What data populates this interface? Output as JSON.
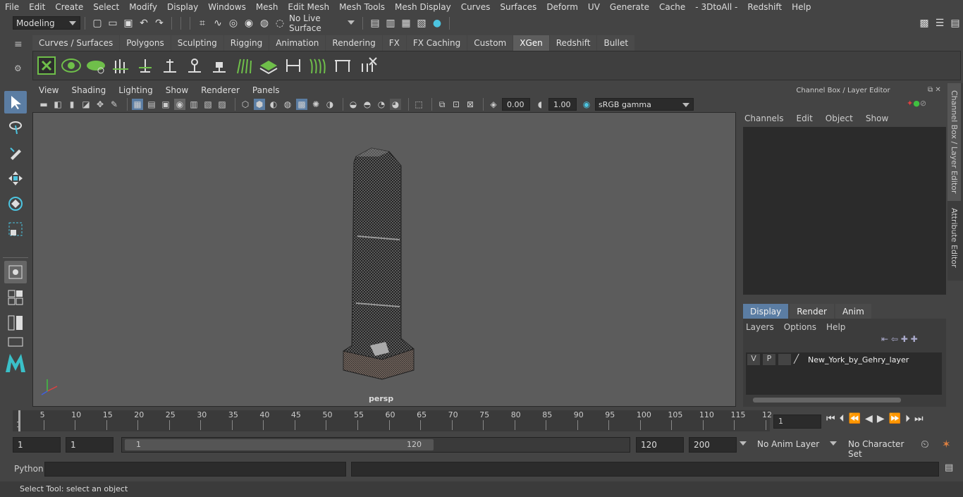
{
  "menu": [
    "File",
    "Edit",
    "Create",
    "Select",
    "Modify",
    "Display",
    "Windows",
    "Mesh",
    "Edit Mesh",
    "Mesh Tools",
    "Mesh Display",
    "Curves",
    "Surfaces",
    "Deform",
    "UV",
    "Generate",
    "Cache",
    "- 3DtoAll -",
    "Redshift",
    "Help"
  ],
  "status": {
    "mode": "Modeling",
    "live_surface": "No Live Surface"
  },
  "shelf_tabs": [
    "Curves / Surfaces",
    "Polygons",
    "Sculpting",
    "Rigging",
    "Animation",
    "Rendering",
    "FX",
    "FX Caching",
    "Custom",
    "XGen",
    "Redshift",
    "Bullet"
  ],
  "shelf_active": "XGen",
  "viewport": {
    "menu": [
      "View",
      "Shading",
      "Lighting",
      "Show",
      "Renderer",
      "Panels"
    ],
    "exposure": "0.00",
    "gamma": "1.00",
    "color_space": "sRGB gamma",
    "camera": "persp"
  },
  "channel_box": {
    "title": "Channel Box / Layer Editor",
    "menu": [
      "Channels",
      "Edit",
      "Object",
      "Show"
    ],
    "layer_tabs": [
      "Display",
      "Render",
      "Anim"
    ],
    "layer_menu": [
      "Layers",
      "Options",
      "Help"
    ],
    "layer": {
      "v": "V",
      "p": "P",
      "name": "New_York_by_Gehry_layer"
    }
  },
  "side_tabs": [
    "Channel Box / Layer Editor",
    "Attribute Editor"
  ],
  "timeline": {
    "ticks": [
      "5",
      "10",
      "15",
      "20",
      "25",
      "30",
      "35",
      "40",
      "45",
      "50",
      "55",
      "60",
      "65",
      "70",
      "75",
      "80",
      "85",
      "90",
      "95",
      "100",
      "105",
      "110",
      "115",
      "12"
    ],
    "start_tick": "1",
    "current": "1"
  },
  "range": {
    "start": "1",
    "playback_start": "1",
    "slider_start": "1",
    "slider_end": "120",
    "playback_end": "120",
    "end": "200",
    "anim_layer": "No Anim Layer",
    "char_set": "No Character Set"
  },
  "cmd": {
    "label": "Python"
  },
  "help": "Select Tool: select an object",
  "colors": {
    "accent": "#5b7da3",
    "xgen_green": "#6fbf4a"
  }
}
